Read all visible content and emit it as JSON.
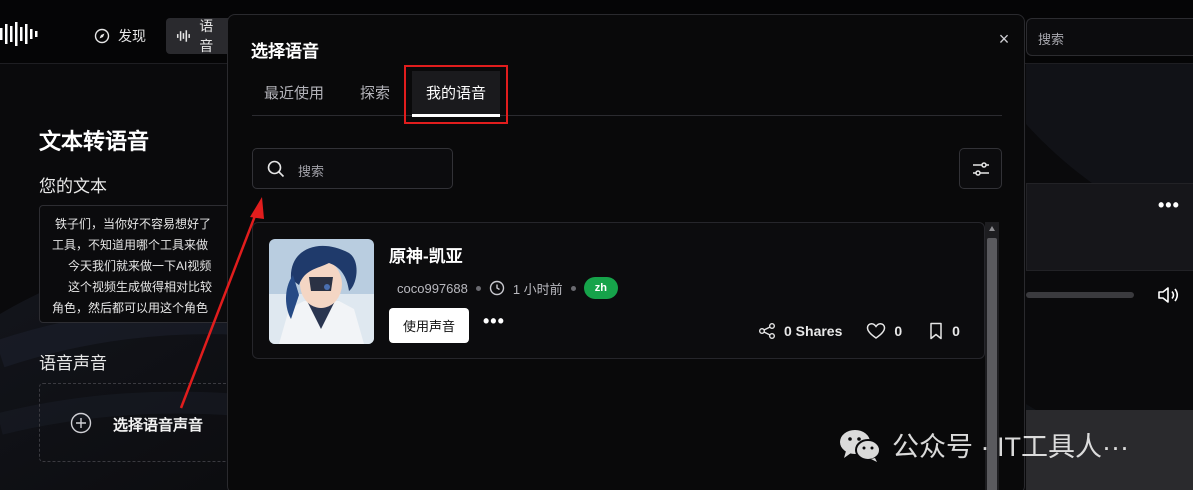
{
  "topbar": {
    "nav_discover": "发现",
    "nav_voice": "语音",
    "search_placeholder": "搜索"
  },
  "main": {
    "title": "文本转语音",
    "your_text_label": "您的文本",
    "text_lines": [
      "铁子们，当你好不容易想好了",
      "工具，不知道用哪个工具来做",
      "今天我们就来做一下AI视频",
      "这个视频生成做得相对比较",
      "角色，然后都可以用这个角色"
    ],
    "voice_label": "语音声音",
    "select_voice": "选择语音声音"
  },
  "modal": {
    "title": "选择语音",
    "close": "×",
    "tabs": [
      {
        "label": "最近使用",
        "active": false
      },
      {
        "label": "探索",
        "active": false
      },
      {
        "label": "我的语音",
        "active": true
      }
    ],
    "search_placeholder": "搜索",
    "voice": {
      "name": "原神-凯亚",
      "author": "coco997688",
      "time": "1 小时前",
      "lang": "zh",
      "use_button": "使用声音",
      "shares": "0 Shares",
      "likes": "0",
      "saves": "0"
    }
  },
  "watermark": "公众号 · IT工具人···",
  "colors": {
    "accent_red": "#e11d1d",
    "badge_green": "#16a34a"
  }
}
